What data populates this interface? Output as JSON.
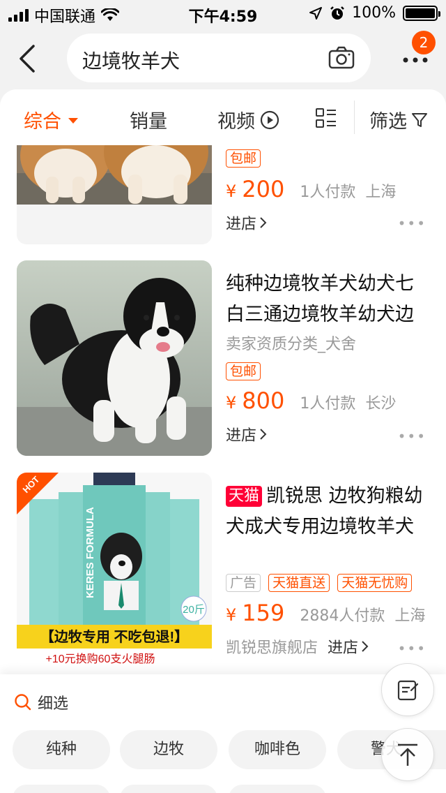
{
  "status_bar": {
    "carrier": "中国联通",
    "time": "下午4:59",
    "battery_percent": "100%",
    "battery_level": 1.0
  },
  "search": {
    "query": "边境牧羊犬",
    "notification_count": "2"
  },
  "sort_tabs": [
    {
      "label": "综合",
      "active": true
    },
    {
      "label": "销量",
      "active": false
    },
    {
      "label": "视频",
      "active": false
    },
    {
      "label": "筛选",
      "active": false
    }
  ],
  "products": [
    {
      "tags": [
        "包邮"
      ],
      "currency": "¥",
      "price": "200",
      "sales": "1人付款",
      "location": "上海",
      "store_link": "进店"
    },
    {
      "title": "纯种边境牧羊犬幼犬七白三通边境牧羊幼犬边",
      "subtitle": "卖家资质分类_犬舍",
      "tags": [
        "包邮"
      ],
      "currency": "¥",
      "price": "800",
      "sales": "1人付款",
      "location": "长沙",
      "store_link": "进店"
    },
    {
      "platform_badge": "天猫",
      "title": "凯锐思 边牧狗粮幼犬成犬专用边境牧羊犬",
      "ad_label": "广告",
      "tags": [
        "天猫直送",
        "天猫无忧购"
      ],
      "currency": "¥",
      "price": "159",
      "sales": "2884人付款",
      "location": "上海",
      "shop_name": "凯锐思旗舰店",
      "store_link": "进店",
      "image_text": {
        "hot": "HOT",
        "brand": "KERES FORMULA",
        "weight": "20斤",
        "banner": "【边牧专用 不吃包退!】",
        "promo": "+10元换购60支火腿肠"
      }
    }
  ],
  "filter_panel": {
    "title": "细选",
    "chips": [
      "纯种",
      "边牧",
      "咖啡色",
      "警犬"
    ]
  },
  "colors": {
    "accent": "#ff5000",
    "tmall": "#ff0036",
    "muted": "#999999"
  },
  "icons": [
    "back-arrow-icon",
    "camera-icon",
    "more-dots-icon",
    "play-circle-icon",
    "list-grid-icon",
    "filter-funnel-icon",
    "search-icon",
    "notepad-icon",
    "arrow-up-icon",
    "chevron-right-icon"
  ]
}
